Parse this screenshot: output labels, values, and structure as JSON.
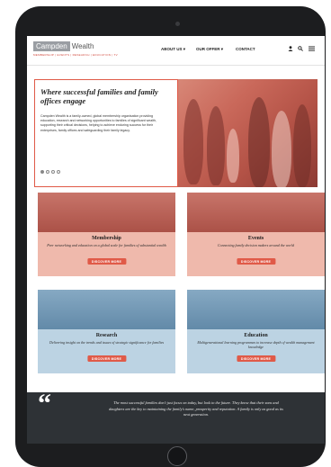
{
  "header": {
    "logo_left": "Campden",
    "logo_right": "Wealth",
    "logo_tagline": "MEMBERSHIP | EVENTS | RESEARCH | EDUCATION | TV",
    "nav": [
      {
        "label": "ABOUT US ▾"
      },
      {
        "label": "OUR OFFER ▾"
      },
      {
        "label": "CONTACT"
      }
    ]
  },
  "hero": {
    "title": "Where successful families and family offices engage",
    "body": "Campden Wealth is a family-owned, global membership organisation providing education, research and networking opportunities to families of significant wealth, supporting their critical decisions, helping to achieve enduring success for their enterprises, family offices and safeguarding their family legacy."
  },
  "tiles": [
    {
      "title": "Membership",
      "desc": "Peer networking and education on a global scale for families of substantial wealth",
      "button": "DISCOVER MORE"
    },
    {
      "title": "Events",
      "desc": "Connecting family decision makers around the world",
      "button": "DISCOVER MORE"
    },
    {
      "title": "Research",
      "desc": "Delivering insight on the trends and issues of strategic significance for families",
      "button": "DISCOVER MORE"
    },
    {
      "title": "Education",
      "desc": "Multigenerational learning programmes to increase depth of wealth management knowledge",
      "button": "DISCOVER MORE"
    }
  ],
  "quote": {
    "mark": "“",
    "text": "The most successful families don't just focus on today, but look to the future. They know that their sons and daughters are the key to maintaining the family's name, prosperity and reputation. A family is only as good as its next generation."
  },
  "colors": {
    "accent": "#e05a48",
    "red_tint": "#efb9ac",
    "blue_tint": "#bcd3e3",
    "quote_bg": "#2e3236"
  },
  "icons": [
    "user-icon",
    "search-icon",
    "menu-icon"
  ]
}
